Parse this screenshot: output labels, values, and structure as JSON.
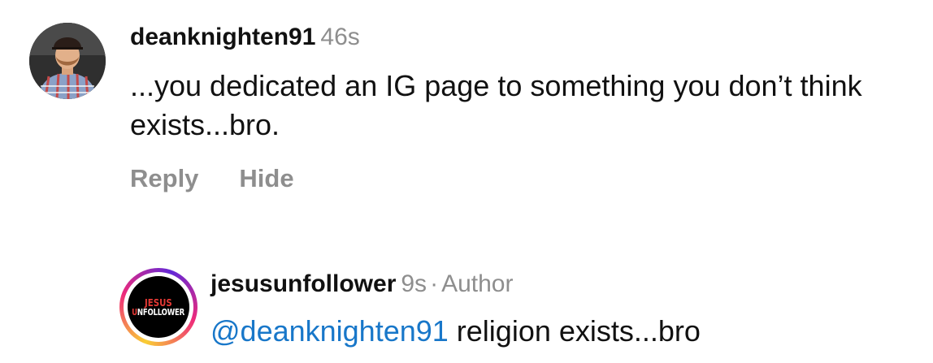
{
  "comments": [
    {
      "username": "deanknighten91",
      "time": "46s",
      "text": "...you dedicated an IG page to something you don’t think exists...bro.",
      "actions": {
        "reply": "Reply",
        "hide": "Hide"
      }
    }
  ],
  "reply": {
    "username": "jesusunfollower",
    "time": "9s",
    "separator": "·",
    "badge": "Author",
    "mention": "@deanknighten91",
    "text": "religion exists...bro",
    "avatar_logo": {
      "line1": "JESUS",
      "line2_first": "U",
      "line2_rest": "NFOLLOWER"
    }
  },
  "colors": {
    "text": "#111111",
    "secondary": "#8e8e8e",
    "mention": "#1877c9",
    "logo_red": "#e53935"
  },
  "icons": {
    "avatar_1": "user-photo-avatar",
    "avatar_2": "jesus-unfollower-logo-avatar"
  }
}
